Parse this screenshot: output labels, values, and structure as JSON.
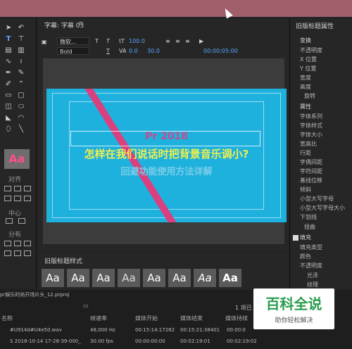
{
  "editor": {
    "tab_title": "字幕: 字幕 03",
    "font_family": "微软...",
    "font_style": "Bold",
    "font_size": "100.0",
    "leading": "0.0",
    "kerning": "30.0",
    "timecode": "00:00:05:00",
    "text_line1": "Pr 2018",
    "text_line2": "怎样在我们说话时把背景音乐调小?",
    "text_line3": "回避功能使用方法详解"
  },
  "tools": {
    "align_label": "对齐",
    "center_label": "中心",
    "distribute_label": "分布",
    "style_sample": "Aa"
  },
  "properties": {
    "title": "旧版标题属性",
    "transform": "变换",
    "transform_items": [
      "不透明度",
      "X 位置",
      "Y 位置",
      "宽度",
      "高度"
    ],
    "rotate": "旋转",
    "attributes": "属性",
    "attribute_items": [
      "字体系列",
      "字体样式",
      "字体大小",
      "宽高比",
      "行距",
      "字偶间距",
      "字符间距",
      "基线位移",
      "倾斜",
      "小型大写字母",
      "小型大写字母大小",
      "下划线"
    ],
    "distort": "扭曲",
    "fill": "填充",
    "fill_items": [
      "填充类型",
      "颜色",
      "不透明度"
    ],
    "gloss": "光泽",
    "texture": "纹理"
  },
  "styles_panel": {
    "title": "旧版标题样式",
    "samples": [
      "Aa",
      "Aa",
      "Aa",
      "Aa",
      "Aa",
      "Aa",
      "Aa",
      "Aa"
    ]
  },
  "project": {
    "file": "pr娱乐时尚开场片头_12.prproj",
    "items_count": "1 项已",
    "columns": [
      "名称",
      "帧速率",
      "媒体开始",
      "媒体结束",
      "媒体持续"
    ],
    "rows": [
      {
        "name": "#U914d#U4e50.wav",
        "rate": "48,000 Hz",
        "start": "00:15:14:17282",
        "end": "00:15:21:38401",
        "dur": "00:00:0"
      },
      {
        "name": "S 2018-10-14 17-28-39-000_",
        "rate": "30.00 fps",
        "start": "00:00:00:00",
        "end": "00:02:19:01",
        "dur": "00:02:19:02"
      }
    ]
  },
  "watermark": {
    "main": "百科全说",
    "sub": "助你轻松解决"
  },
  "colors": {
    "top_bar": "#a0606b",
    "canvas": "#1fb1de",
    "stripe": "#d8407e",
    "title_yellow": "#f2ef4c",
    "title_pink": "#c34d8f",
    "accent_blue": "#58a6ff"
  }
}
